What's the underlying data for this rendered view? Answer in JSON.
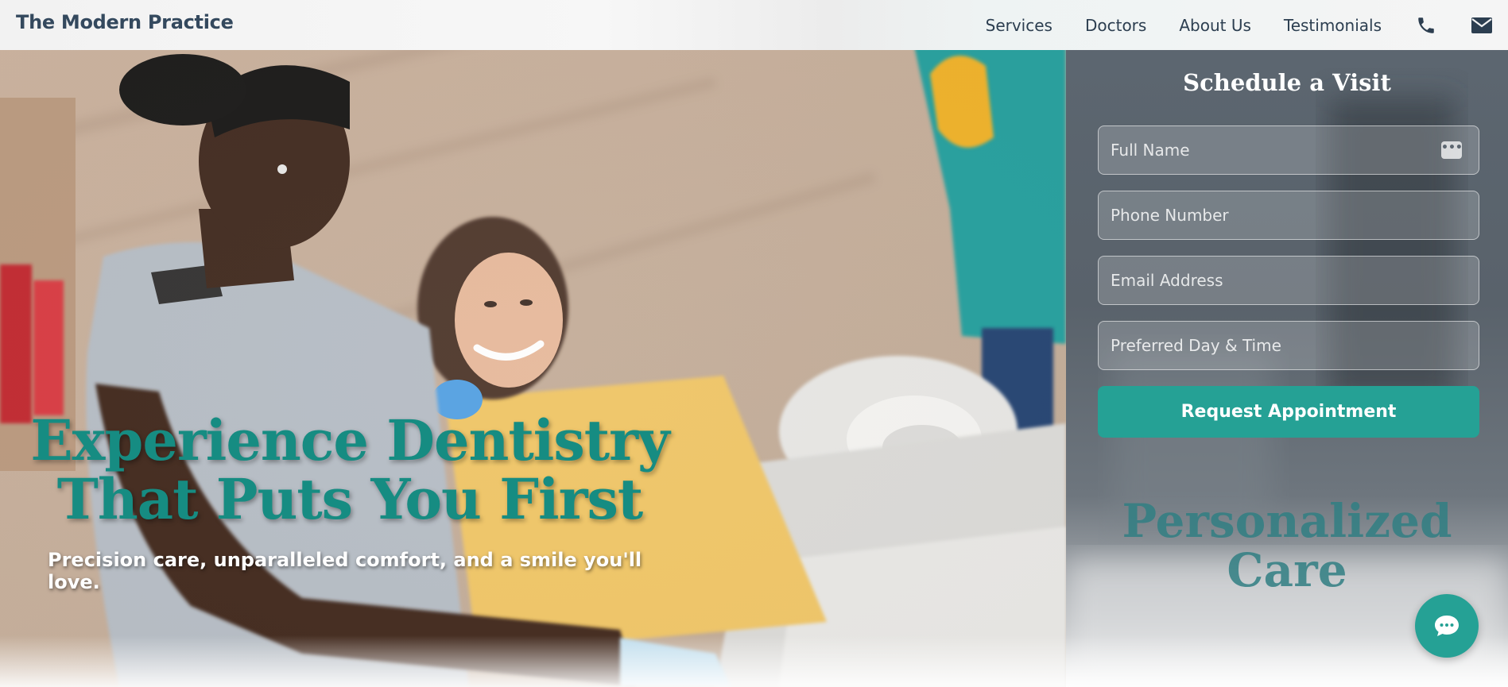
{
  "header": {
    "logo": "The Modern Practice",
    "nav": [
      {
        "label": "Services"
      },
      {
        "label": "Doctors"
      },
      {
        "label": "About Us"
      },
      {
        "label": "Testimonials"
      }
    ],
    "icons": [
      "phone-icon",
      "envelope-icon"
    ]
  },
  "hero": {
    "title_line1": "Experience Dentistry",
    "title_line2": "That Puts You First",
    "subtitle": "Precision care, unparalleled comfort, and a smile you'll love."
  },
  "form": {
    "title": "Schedule a Visit",
    "fields": [
      {
        "placeholder": "Full Name",
        "value": ""
      },
      {
        "placeholder": "Phone Number",
        "value": ""
      },
      {
        "placeholder": "Email Address",
        "value": ""
      },
      {
        "placeholder": "Preferred Day & Time",
        "value": ""
      }
    ],
    "submit_label": "Request Appointment"
  },
  "panel_deco": {
    "line1": "Personalized",
    "line2": "Care"
  },
  "colors": {
    "accent": "#25a195",
    "hero_title": "#168c82",
    "header_text": "#34495e"
  },
  "chat": {
    "icon": "chat-bubble-icon"
  }
}
